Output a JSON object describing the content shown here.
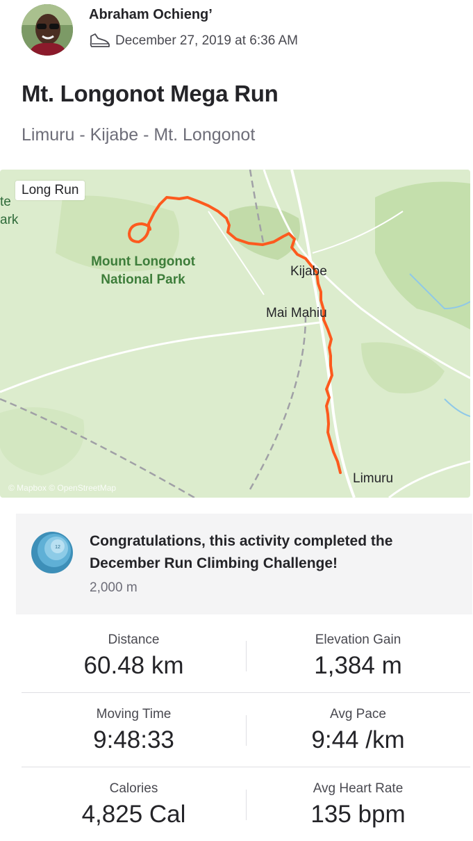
{
  "athlete": {
    "name": "Abraham Ochieng’"
  },
  "activity": {
    "date": "December 27, 2019 at 6:36 AM",
    "sport_icon": "shoe-icon",
    "title": "Mt. Longonot Mega Run",
    "description": "Limuru - Kijabe - Mt. Longonot"
  },
  "map": {
    "workout_type": "Long Run",
    "labels": {
      "park_name_line1": "Mount Longonot",
      "park_name_line2": "National Park",
      "edge_text_1": "te",
      "edge_text_2": "ark",
      "town_kijabe": "Kijabe",
      "town_mai_mahiu": "Mai Mahiu",
      "town_limuru": "Limuru"
    },
    "attribution": "© Mapbox © OpenStreetMap",
    "colors": {
      "route": "#fc5a1e",
      "land": "#dceccd",
      "park": "#bcdaa6",
      "road": "#ffffff"
    }
  },
  "challenge": {
    "badge_number": "12",
    "message": "Congratulations, this activity completed the December Run Climbing Challenge!",
    "goal": "2,000 m"
  },
  "stats": [
    {
      "left": {
        "label": "Distance",
        "value": "60.48 km"
      },
      "right": {
        "label": "Elevation Gain",
        "value": "1,384 m"
      }
    },
    {
      "left": {
        "label": "Moving Time",
        "value": "9:48:33"
      },
      "right": {
        "label": "Avg Pace",
        "value": "9:44 /km"
      }
    },
    {
      "left": {
        "label": "Calories",
        "value": "4,825 Cal"
      },
      "right": {
        "label": "Avg Heart Rate",
        "value": "135 bpm"
      }
    }
  ]
}
